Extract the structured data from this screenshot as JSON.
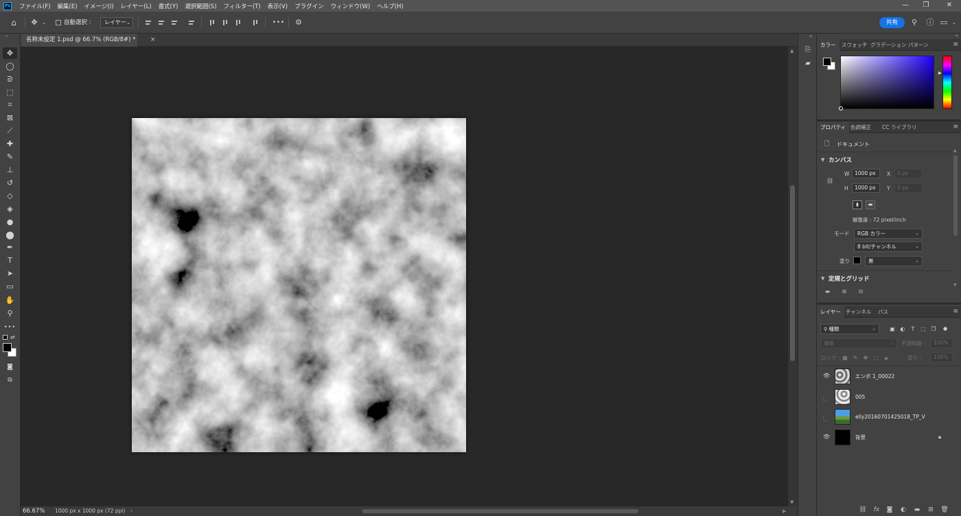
{
  "app": {
    "logo": "Ps"
  },
  "menu": [
    "ファイル(F)",
    "編集(E)",
    "イメージ(I)",
    "レイヤー(L)",
    "書式(Y)",
    "選択範囲(S)",
    "フィルター(T)",
    "表示(V)",
    "プラグイン",
    "ウィンドウ(W)",
    "ヘルプ(H)"
  ],
  "window_controls": {
    "minimize": "—",
    "restore": "❐",
    "close": "✕"
  },
  "options": {
    "auto_select_label": "自動選択 :",
    "auto_select_checked": false,
    "target_select": "レイヤー",
    "more": "•••",
    "share_label": "共有"
  },
  "document": {
    "tab_title": "名称未設定 1.psd @ 66.7% (RGB/8#) *",
    "close": "×",
    "zoom_status": "66.67%",
    "size_status": "1000 px x 1000 px (72 ppi)",
    "status_chevron": "›",
    "canvas_content": "grayscale clouds texture"
  },
  "toolbar": {
    "tools": [
      {
        "name": "move-tool-icon",
        "glyph": "✥",
        "active": true
      },
      {
        "name": "marquee-tool-icon",
        "glyph": "◯"
      },
      {
        "name": "lasso-tool-icon",
        "glyph": "ᘐ"
      },
      {
        "name": "object-select-tool-icon",
        "glyph": "⬚"
      },
      {
        "name": "crop-tool-icon",
        "glyph": "⌗"
      },
      {
        "name": "frame-tool-icon",
        "glyph": "⊠"
      },
      {
        "name": "eyedropper-tool-icon",
        "glyph": "⟋"
      },
      {
        "name": "healing-brush-tool-icon",
        "glyph": "✚"
      },
      {
        "name": "brush-tool-icon",
        "glyph": "✎"
      },
      {
        "name": "stamp-tool-icon",
        "glyph": "⊥"
      },
      {
        "name": "history-brush-tool-icon",
        "glyph": "↺"
      },
      {
        "name": "eraser-tool-icon",
        "glyph": "◇"
      },
      {
        "name": "paint-bucket-tool-icon",
        "glyph": "◈"
      },
      {
        "name": "blur-tool-icon",
        "glyph": "●"
      },
      {
        "name": "dodge-tool-icon",
        "glyph": "⬤"
      },
      {
        "name": "pen-tool-icon",
        "glyph": "✒"
      },
      {
        "name": "type-tool-icon",
        "glyph": "T"
      },
      {
        "name": "path-select-tool-icon",
        "glyph": "➤"
      },
      {
        "name": "rectangle-tool-icon",
        "glyph": "▭"
      },
      {
        "name": "hand-tool-icon",
        "glyph": "✋"
      },
      {
        "name": "zoom-tool-icon",
        "glyph": "⚲"
      },
      {
        "name": "more-tools-icon",
        "glyph": "•••"
      }
    ]
  },
  "color_panel": {
    "tabs": [
      "カラー",
      "スウォッチ",
      "グラデーション",
      "パターン"
    ],
    "foreground": "#000000",
    "background": "#ffffff",
    "hue_color": "#1f00ff"
  },
  "properties_panel": {
    "tabs": [
      "プロパティ",
      "色調補正",
      "CC ライブラリ"
    ],
    "doc_label": "ドキュメント",
    "canvas_heading": "カンバス",
    "w_label": "W",
    "w_value": "1000 px",
    "h_label": "H",
    "h_value": "1000 px",
    "x_label": "X",
    "x_placeholder": "0 px",
    "y_label": "Y",
    "y_placeholder": "0 px",
    "resolution": "解像度 : 72 pixel/inch",
    "mode_label": "モード",
    "mode_value": "RGB カラー",
    "depth_value": "8 bit/チャンネル",
    "fill_label": "塗り",
    "fill_value": "黒",
    "guides_heading": "定規とグリッド"
  },
  "layers_panel": {
    "tabs": [
      "レイヤー",
      "チャンネル",
      "パス"
    ],
    "filter_kind": "種類",
    "blend_mode": "通常",
    "opacity_label": "不透明度 :",
    "opacity_value": "100%",
    "lock_label": "ロック :",
    "fill_label": "塗り :",
    "fill_value": "100%",
    "layers": [
      {
        "name": "エンボ 1_00022",
        "visible": true,
        "thumb": "noise",
        "locked": false
      },
      {
        "name": "005",
        "visible": false,
        "thumb": "noise-light",
        "locked": false
      },
      {
        "name": "elly20160701425018_TP_V",
        "visible": false,
        "thumb": "photo",
        "locked": false
      },
      {
        "name": "背景",
        "visible": true,
        "thumb": "black",
        "locked": true
      }
    ]
  }
}
